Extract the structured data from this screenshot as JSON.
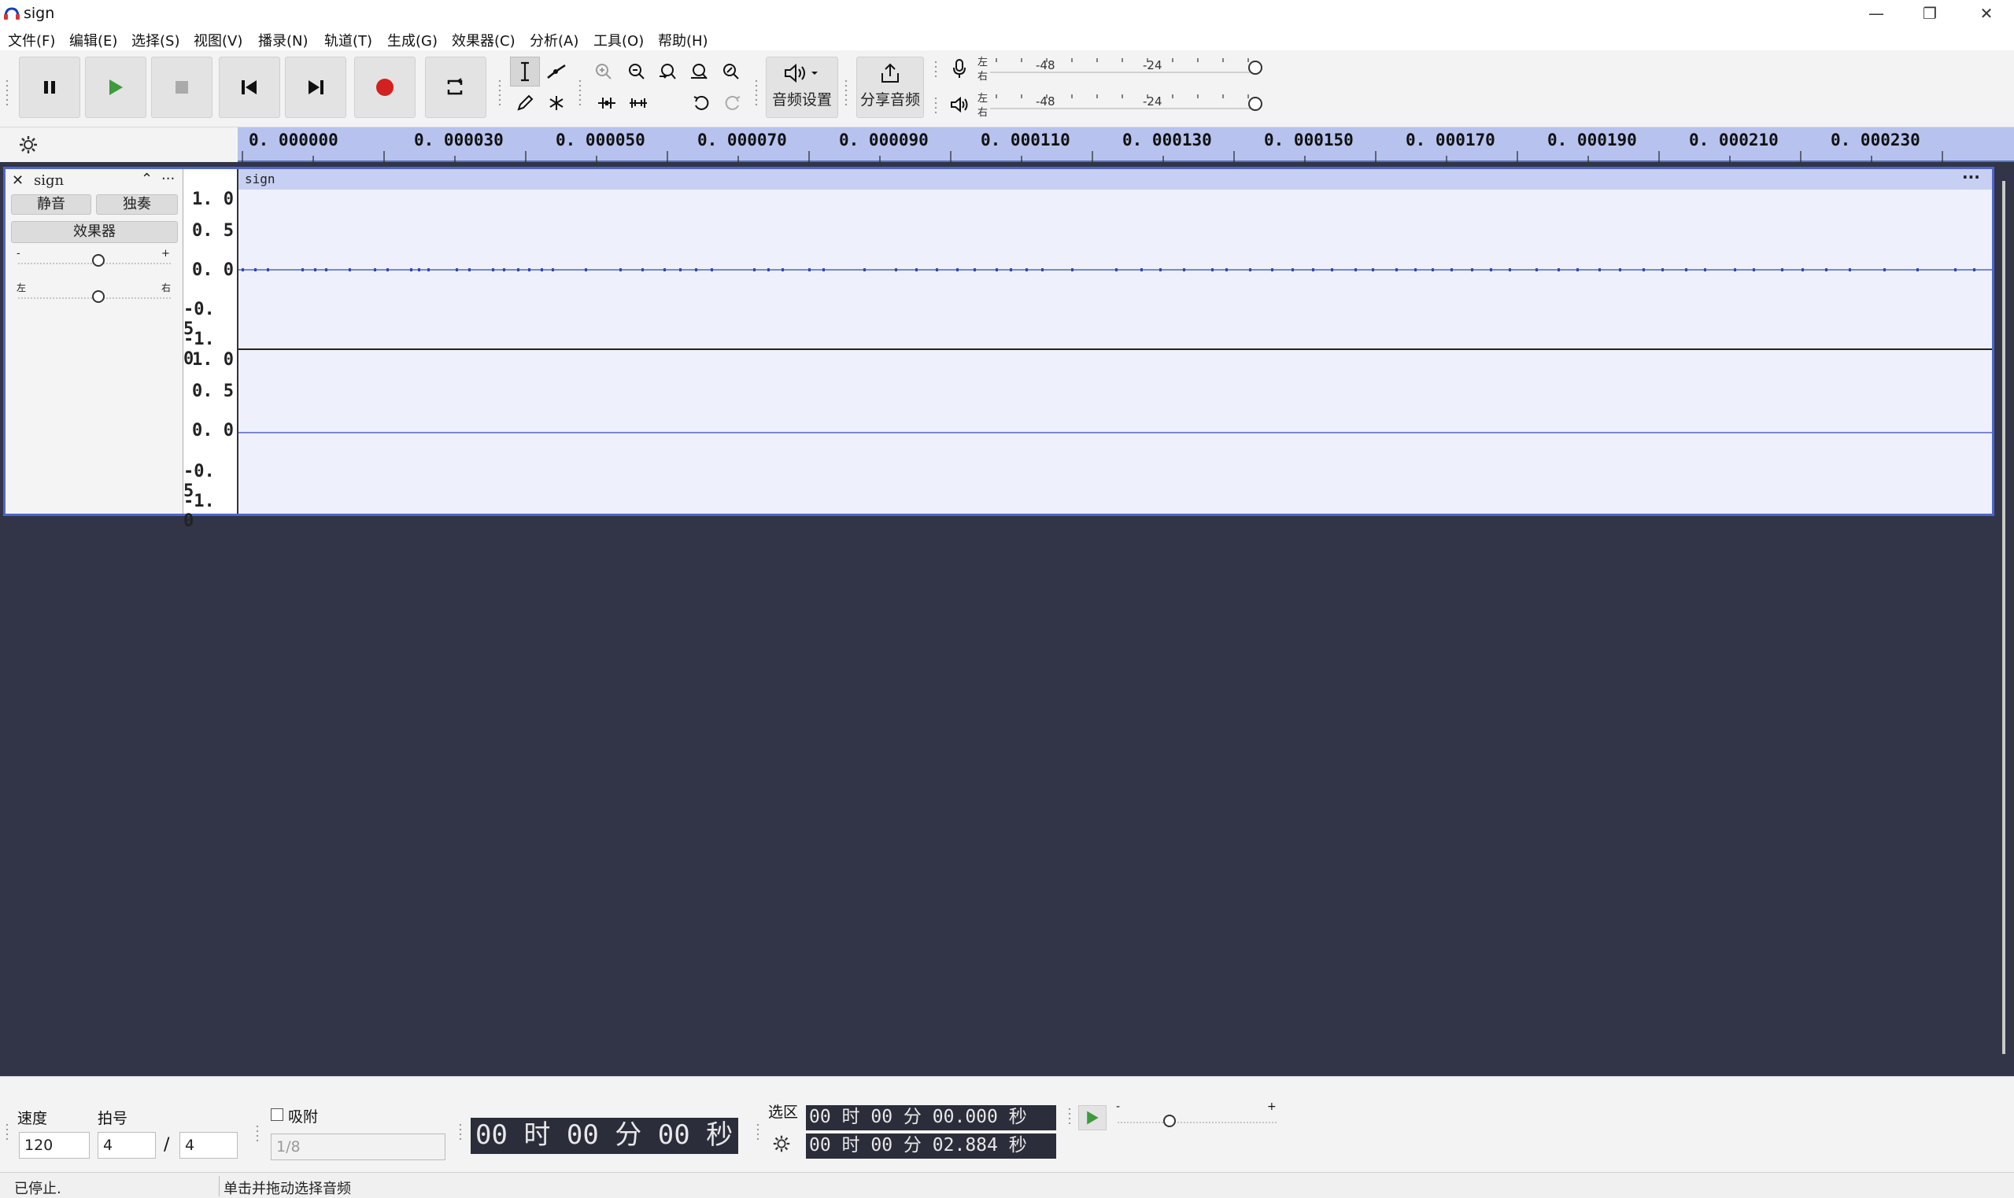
{
  "window": {
    "title": "sign",
    "minimize": "—",
    "restore": "❐",
    "close": "✕"
  },
  "menu": [
    "文件(F)",
    "编辑(E)",
    "选择(S)",
    "视图(V)",
    "播录(N)",
    "轨道(T)",
    "生成(G)",
    "效果器(C)",
    "分析(A)",
    "工具(O)",
    "帮助(H)"
  ],
  "toolbar": {
    "audio_setup_label": "音频设置",
    "share_audio_label": "分享音频",
    "meter_ticks": [
      "-48",
      "-24"
    ],
    "meter_lr": [
      "左",
      "右"
    ]
  },
  "ruler": {
    "ticks": [
      "0. 000000",
      "0. 000030",
      "0. 000050",
      "0. 000070",
      "0. 000090",
      "0. 000110",
      "0. 000130",
      "0. 000150",
      "0. 000170",
      "0. 000190",
      "0. 000210",
      "0. 000230"
    ]
  },
  "track": {
    "name": "sign",
    "clip_name": "sign",
    "mute_label": "静音",
    "solo_label": "独奏",
    "effects_label": "效果器",
    "gain_minus": "-",
    "gain_plus": "+",
    "pan_left": "左",
    "pan_right": "右",
    "scale_top": [
      "1. 0",
      "0. 5",
      "0. 0",
      "-0. 5",
      "-1. 0"
    ],
    "scale_bottom": [
      "1. 0",
      "0. 5",
      "0. 0",
      "-0. 5",
      "-1. 0"
    ]
  },
  "bottom": {
    "tempo_label": "速度",
    "tempo_value": "120",
    "time_sig_label": "拍号",
    "time_sig_num": "4",
    "time_sig_sep": "/",
    "time_sig_den": "4",
    "snap_label": "吸附",
    "snap_value": "1/8",
    "time_display": "00 时 00 分 00 秒",
    "selection_label": "选区",
    "sel_start": "00 时 00 分 00.000 秒",
    "sel_end": "00 时 00 分 02.884 秒",
    "play_speed_minus": "-",
    "play_speed_plus": "+"
  },
  "status": {
    "state": "已停止.",
    "hint": "单击并拖动选择音频"
  },
  "colors": {
    "accent": "#4e66c9",
    "ruler": "#b7c3ee",
    "waveform": "#3446b8",
    "record": "#d32020",
    "play": "#3e9a3e",
    "dark_bg": "#323547"
  }
}
